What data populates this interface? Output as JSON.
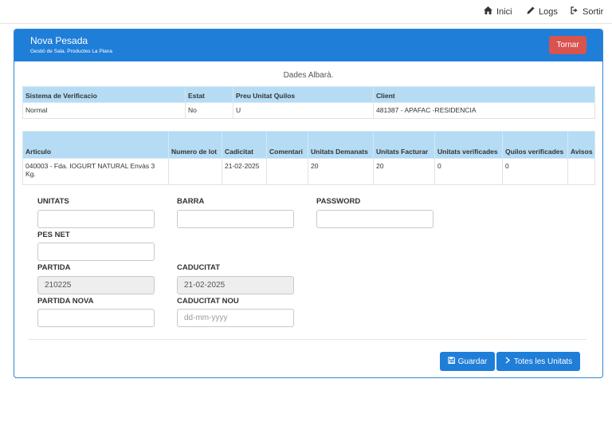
{
  "nav": {
    "inici": {
      "icon": "home-icon",
      "label": "Inici"
    },
    "logs": {
      "icon": "pencil-icon",
      "label": "Logs"
    },
    "sortir": {
      "icon": "sign-out-icon",
      "label": "Sortir"
    }
  },
  "panel": {
    "title": "Nova Pesada",
    "subtitle": "Gestió de Sala. Productes La Plana",
    "back_button": "Tornar",
    "section_title": "Dades Albarà."
  },
  "albara_table": {
    "headers": [
      "Sistema de Verificacio",
      "Estat",
      "Preu Unitat Quilos",
      "Client"
    ],
    "row": [
      "Normal",
      "No",
      "U",
      "481387 - APAFAC -RESIDENCIA"
    ]
  },
  "article_table": {
    "headers": [
      "Articulo",
      "Numero de lot",
      "Cadicitat",
      "Comentari",
      "Unitats Demanats",
      "Unitats Facturar",
      "Unitats verificades",
      "Quilos verificades",
      "Avisos"
    ],
    "row": [
      "040003 - Fda. IOGURT NATURAL Envàs 3 Kg.",
      "",
      "21-02-2025",
      "",
      "20",
      "20",
      "0",
      "0",
      ""
    ]
  },
  "form": {
    "unitats": {
      "label": "UNITATS",
      "value": ""
    },
    "barra": {
      "label": "BARRA",
      "value": ""
    },
    "password": {
      "label": "PASSWORD",
      "value": ""
    },
    "pes_net": {
      "label": "PES NET",
      "value": ""
    },
    "partida": {
      "label": "PARTIDA",
      "value": "210225"
    },
    "caducitat": {
      "label": "CADUCITAT",
      "value": "21-02-2025"
    },
    "partida_nova": {
      "label": "PARTIDA NOVA",
      "value": ""
    },
    "caducitat_nou": {
      "label": "CADUCITAT NOU",
      "placeholder": "dd-mm-yyyy"
    }
  },
  "buttons": {
    "guardar": {
      "icon": "save-icon",
      "label": "Guardar"
    },
    "totes": {
      "icon": "chevron-right-icon",
      "label": "Totes les Unitats"
    }
  },
  "colors": {
    "primary": "#1f7ed8",
    "danger": "#d9534f",
    "table_header": "#b5dcf4"
  }
}
